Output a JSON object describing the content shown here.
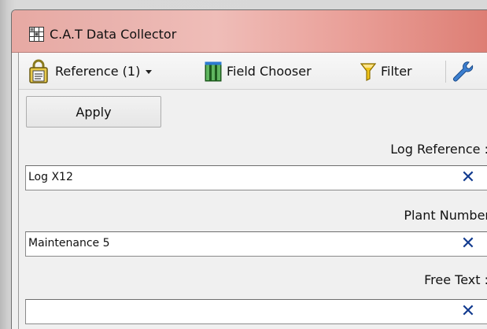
{
  "window": {
    "title": "C.A.T Data Collector",
    "title_icon": "grid-app-icon"
  },
  "toolbar": {
    "reference_label": "Reference (1)",
    "reference_icon": "lock-document-icon",
    "field_chooser_label": "Field Chooser",
    "field_chooser_icon": "columns-icon",
    "filter_label": "Filter",
    "filter_icon": "funnel-icon",
    "tools_icon": "wrench-icon"
  },
  "form": {
    "apply_label": "Apply",
    "fields": [
      {
        "label": "Log Reference :",
        "value": "Log X12",
        "clear_icon": "clear-x-icon"
      },
      {
        "label": "Plant Number",
        "value": "Maintenance 5",
        "clear_icon": "clear-x-icon"
      },
      {
        "label": "Free Text :",
        "value": "",
        "clear_icon": "clear-x-icon"
      }
    ]
  },
  "colors": {
    "titlebar_accent": "#dd7e74",
    "clear_x": "#123b8f"
  }
}
